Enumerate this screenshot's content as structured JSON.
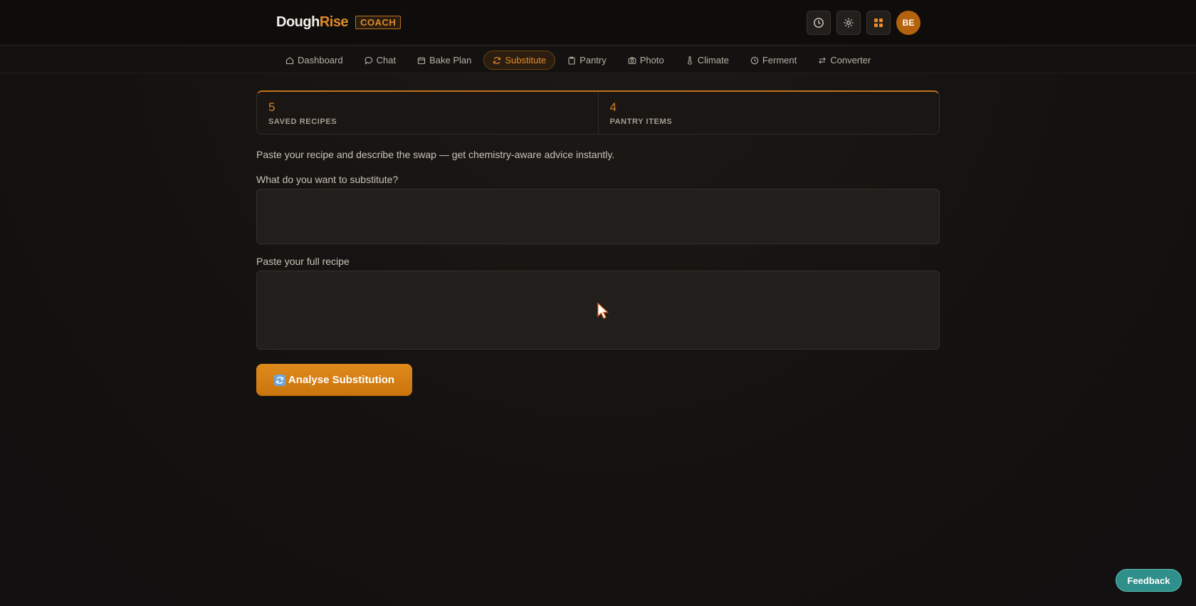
{
  "header": {
    "logo_part1": "Dough",
    "logo_part2": "Rise",
    "badge": "COACH",
    "avatar_initials": "BE",
    "accent_color": "#e08a2a"
  },
  "nav": {
    "items": [
      {
        "label": "Dashboard",
        "icon": "home-icon"
      },
      {
        "label": "Chat",
        "icon": "chat-bubble-icon"
      },
      {
        "label": "Bake Plan",
        "icon": "calendar-icon"
      },
      {
        "label": "Substitute",
        "icon": "refresh-icon",
        "active": true
      },
      {
        "label": "Pantry",
        "icon": "clipboard-icon"
      },
      {
        "label": "Photo",
        "icon": "camera-icon"
      },
      {
        "label": "Climate",
        "icon": "thermometer-icon"
      },
      {
        "label": "Ferment",
        "icon": "clock-icon"
      },
      {
        "label": "Converter",
        "icon": "swap-arrows-icon"
      }
    ]
  },
  "stats": {
    "recipes_value": "5",
    "recipes_label": "SAVED RECIPES",
    "pantry_value": "4",
    "pantry_label": "PANTRY ITEMS"
  },
  "form": {
    "intro": "Paste your recipe and describe the swap — get chemistry-aware advice instantly.",
    "substitute_label": "What do you want to substitute?",
    "substitute_value": "",
    "recipe_label": "Paste your full recipe",
    "recipe_value": "",
    "submit_label": "Analyse Substitution"
  },
  "feedback_label": "Feedback"
}
